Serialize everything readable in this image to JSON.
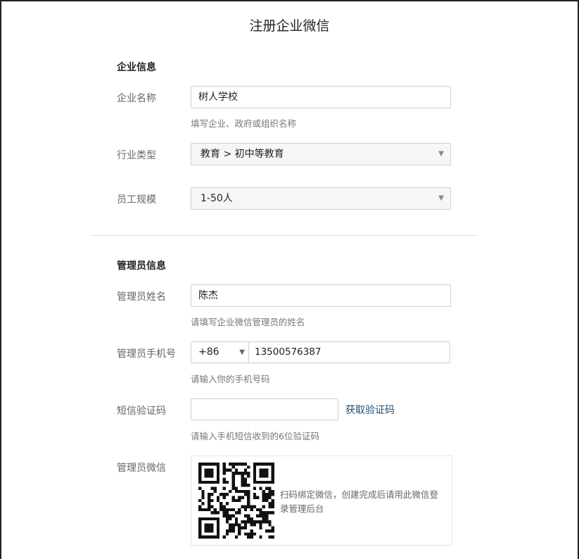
{
  "page": {
    "title": "注册企业微信"
  },
  "company": {
    "section_title": "企业信息",
    "name_label": "企业名称",
    "name_value": "树人学校",
    "name_hint": "填写企业、政府或组织名称",
    "industry_label": "行业类型",
    "industry_value": "教育 > 初中等教育",
    "size_label": "员工规模",
    "size_value": "1-50人"
  },
  "admin": {
    "section_title": "管理员信息",
    "name_label": "管理员姓名",
    "name_value": "陈杰",
    "name_hint": "请填写企业微信管理员的姓名",
    "phone_label": "管理员手机号",
    "country_code": "+86",
    "phone_value": "13500576387",
    "phone_hint": "请输入你的手机号码",
    "sms_label": "短信验证码",
    "sms_value": "",
    "get_code_label": "获取验证码",
    "sms_hint": "请输入手机短信收到的6位验证码",
    "wechat_label": "管理员微信",
    "qr_text": "扫码绑定微信，创建完成后请用此微信登录管理后台"
  },
  "icons": {
    "dropdown": "caret-down-icon",
    "qr": "qr-code-icon"
  },
  "colors": {
    "link": "#1f4e79",
    "label": "#666666",
    "hint": "#777777",
    "border": "#cfcfcf"
  }
}
